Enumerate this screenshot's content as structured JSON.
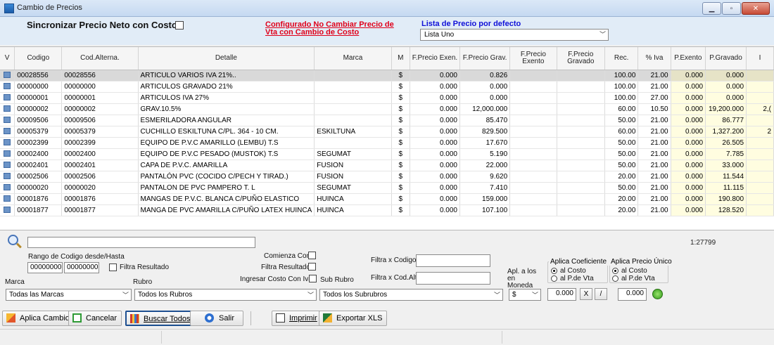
{
  "window": {
    "title": "Cambio de Precios"
  },
  "header": {
    "sync_label": "Sincronizar Precio Neto con Costo",
    "red_note": "Configurado No Cambiar Precio de Vta con Cambio de Costo",
    "lista_label": "Lista de Precio por defecto",
    "lista_value": "Lista Uno"
  },
  "grid": {
    "columns": [
      "V",
      "Codigo",
      "Cod.Alterna.",
      "Detalle",
      "Marca",
      "M",
      "F.Precio Exen.",
      "F.Precio Grav.",
      "F.Precio Exento",
      "F.Precio Gravado",
      "Rec.",
      "% Iva",
      "P.Exento",
      "P.Gravado",
      "I"
    ],
    "rows": [
      [
        "00028556",
        "00028556",
        "ARTICULO VARIOS IVA 21%..",
        "",
        "$",
        "0.000",
        "0.826",
        "",
        "",
        "100.00",
        "21.00",
        "0.000",
        "0.000",
        ""
      ],
      [
        "00000000",
        "00000000",
        "ARTICULOS GRAVADO 21%",
        "",
        "$",
        "0.000",
        "0.000",
        "",
        "",
        "100.00",
        "21.00",
        "0.000",
        "0.000",
        ""
      ],
      [
        "00000001",
        "00000001",
        "ARTICULOS IVA 27%",
        "",
        "$",
        "0.000",
        "0.000",
        "",
        "",
        "100.00",
        "27.00",
        "0.000",
        "0.000",
        ""
      ],
      [
        "00000002",
        "00000002",
        "GRAV.10.5%",
        "",
        "$",
        "0.000",
        "12,000.000",
        "",
        "",
        "60.00",
        "10.50",
        "0.000",
        "19,200.000",
        "2,("
      ],
      [
        "00009506",
        "00009506",
        "ESMERILADORA ANGULAR",
        "",
        "$",
        "0.000",
        "85.470",
        "",
        "",
        "50.00",
        "21.00",
        "0.000",
        "86.777",
        ""
      ],
      [
        "00005379",
        "00005379",
        "CUCHILLO ESKILTUNA C/PL. 364 - 10 CM.",
        "ESKILTUNA",
        "$",
        "0.000",
        "829.500",
        "",
        "",
        "60.00",
        "21.00",
        "0.000",
        "1,327.200",
        "2"
      ],
      [
        "00002399",
        "00002399",
        "EQUIPO DE P.V.C AMARILLO (LEMBU) T.S",
        "",
        "$",
        "0.000",
        "17.670",
        "",
        "",
        "50.00",
        "21.00",
        "0.000",
        "26.505",
        ""
      ],
      [
        "00002400",
        "00002400",
        "EQUIPO DE P.V.C PESADO (MUSTOK) T.S",
        "SEGUMAT",
        "$",
        "0.000",
        "5.190",
        "",
        "",
        "50.00",
        "21.00",
        "0.000",
        "7.785",
        ""
      ],
      [
        "00002401",
        "00002401",
        "CAPA DE P.V.C. AMARILLA",
        "FUSION",
        "$",
        "0.000",
        "22.000",
        "",
        "",
        "50.00",
        "21.00",
        "0.000",
        "33.000",
        ""
      ],
      [
        "00002506",
        "00002506",
        "PANTALÓN  PVC (COCIDO  C/PECH Y TIRAD.)",
        "FUSION",
        "$",
        "0.000",
        "9.620",
        "",
        "",
        "20.00",
        "21.00",
        "0.000",
        "11.544",
        ""
      ],
      [
        "00000020",
        "00000020",
        "PANTALON DE PVC PAMPERO T. L",
        "SEGUMAT",
        "$",
        "0.000",
        "7.410",
        "",
        "",
        "50.00",
        "21.00",
        "0.000",
        "11.115",
        ""
      ],
      [
        "00001876",
        "00001876",
        "MANGAS DE P.V.C. BLANCA C/PUÑO ELASTICO",
        "HUINCA",
        "$",
        "0.000",
        "159.000",
        "",
        "",
        "20.00",
        "21.00",
        "0.000",
        "190.800",
        ""
      ],
      [
        "00001877",
        "00001877",
        "MANGA DE PVC AMARILLA C/PUÑO LATEX HUINCA",
        "HUINCA",
        "$",
        "0.000",
        "107.100",
        "",
        "",
        "20.00",
        "21.00",
        "0.000",
        "128.520",
        ""
      ]
    ]
  },
  "search": {
    "value": "",
    "count": "1:27799"
  },
  "filters": {
    "rango_label": "Rango de Codigo desde/Hasta",
    "desde": "00000000",
    "hasta": "00000000",
    "filtra_resultado": "Filtra Resultado",
    "comienza_con": "Comienza Con",
    "filtra_resultado2": "Filtra Resultado",
    "ingresar_costo": "Ingresar Costo Con Iva",
    "sub_rubro": "Sub Rubro",
    "filtra_codigo": "Filtra x Codigo",
    "filtra_codalt": "Filtra x Cod.Alt.",
    "apl_moneda": "Apl. a los en Moneda",
    "marca_label": "Marca",
    "rubro_label": "Rubro",
    "marca_value": "Todas las Marcas",
    "rubro_value": "Todos los Rubros",
    "subrubro_value": "Todos los Subrubros",
    "moneda_value": "$",
    "coef_title": "Aplica Coeficiente",
    "coef_opt1": "al Costo",
    "coef_opt2": "al P.de Vta",
    "coef_value": "0.000",
    "unico_title": "Aplica Precio Único",
    "unico_opt1": "al Costo",
    "unico_opt2": "al P.de Vta",
    "unico_value": "0.000",
    "mult": "X",
    "div": "/"
  },
  "toolbar": {
    "aplica": "Aplica Cambios",
    "cancelar": "Cancelar",
    "buscar": "Buscar Todos",
    "salir": "Salir",
    "imprimir": "Imprimir",
    "exportar": "Exportar XLS"
  },
  "colors": {
    "header_bg": "#e1ecf7",
    "red_note": "#e0001a",
    "blue_label": "#1010d8",
    "yellow_cell": "#fffde0"
  }
}
